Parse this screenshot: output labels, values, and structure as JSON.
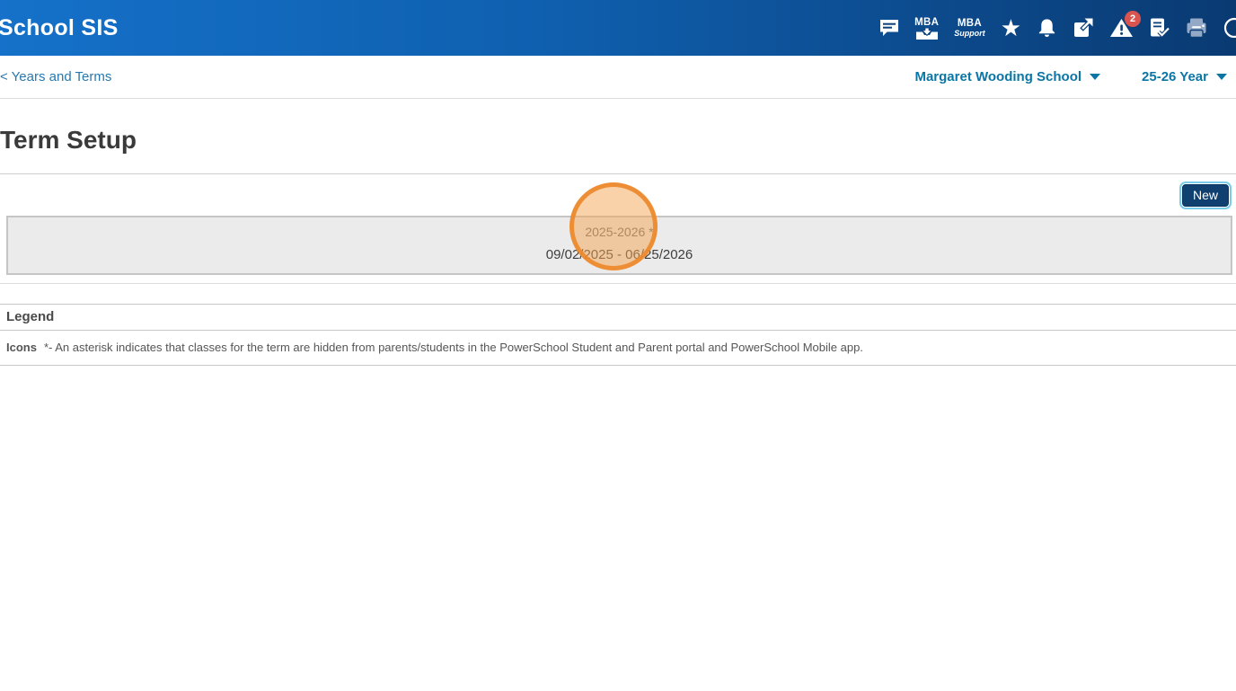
{
  "header": {
    "brand": "School SIS",
    "mba": {
      "label": "MBA"
    },
    "mba_support": {
      "label": "MBA",
      "sublabel": "Support"
    },
    "alert_badge": "2"
  },
  "subheader": {
    "breadcrumb": "< Years and Terms",
    "school_selector": "Margaret Wooding School",
    "year_selector": "25-26 Year"
  },
  "page": {
    "title": "Term Setup",
    "new_button": "New"
  },
  "terms": [
    {
      "name": "2025-2026 *",
      "dates": "09/02/2025 - 06/25/2026"
    }
  ],
  "legend": {
    "heading": "Legend",
    "icons_label": "Icons",
    "icons_text": "*- An asterisk indicates that classes for the term are hidden from parents/students in the PowerSchool Student and Parent portal and PowerSchool Mobile app."
  },
  "annotation": {
    "type": "click-highlight-circle",
    "target": "2025-2026 *"
  },
  "colors": {
    "header_gradient_start": "#1571c9",
    "header_gradient_end": "#0a3a72",
    "link_blue": "#2878ae",
    "selector_teal": "#0b76a5",
    "button_navy": "#10406f",
    "button_focus_ring": "#79cdea",
    "badge_red": "#d9534f",
    "row_gray": "#ebebeb",
    "annotation_orange": "#eb892a"
  }
}
